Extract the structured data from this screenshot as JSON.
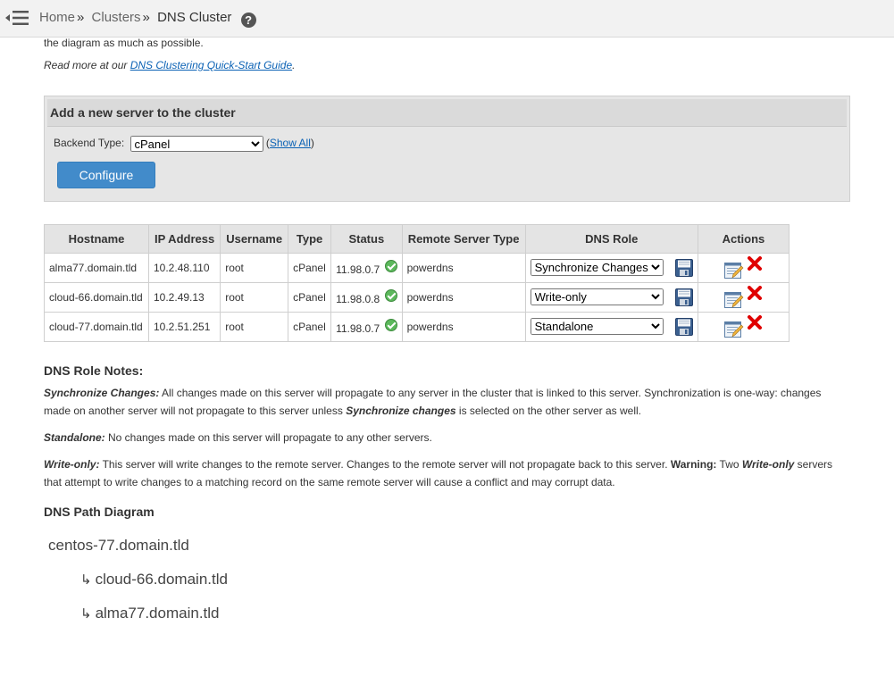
{
  "breadcrumb": {
    "home": "Home",
    "clusters": "Clusters",
    "current": "DNS Cluster",
    "sep1": "»",
    "sep2": "»"
  },
  "intro": {
    "text": "the diagram as much as possible.",
    "readmore_prefix": "Read more at our ",
    "readmore_link": "DNS Clustering Quick-Start Guide",
    "readmore_suffix": "."
  },
  "add_server": {
    "title": "Add a new server to the cluster",
    "backend_label": "Backend Type:",
    "backend_value": "cPanel",
    "show_all_open": "(",
    "show_all": "Show All",
    "show_all_close": ")",
    "configure_label": "Configure"
  },
  "table": {
    "headers": [
      "Hostname",
      "IP Address",
      "Username",
      "Type",
      "Status",
      "Remote Server Type",
      "DNS Role",
      "Actions"
    ],
    "rows": [
      {
        "hostname": "alma77.domain.tld",
        "ip": "10.2.48.110",
        "username": "root",
        "type": "cPanel",
        "status": "11.98.0.7",
        "remote_type": "powerdns",
        "dns_role": "Synchronize Changes"
      },
      {
        "hostname": "cloud-66.domain.tld",
        "ip": "10.2.49.13",
        "username": "root",
        "type": "cPanel",
        "status": "11.98.0.8",
        "remote_type": "powerdns",
        "dns_role": "Write-only"
      },
      {
        "hostname": "cloud-77.domain.tld",
        "ip": "10.2.51.251",
        "username": "root",
        "type": "cPanel",
        "status": "11.98.0.7",
        "remote_type": "powerdns",
        "dns_role": "Standalone"
      }
    ]
  },
  "notes": {
    "title": "DNS Role Notes:",
    "sync_label": "Synchronize Changes:",
    "sync_text1": " All changes made on this server will propagate to any server in the cluster that is linked to this server. Synchronization is one-way: changes made on another server will not propagate to this server unless ",
    "sync_emph": "Synchronize changes",
    "sync_text2": " is selected on the other server as well.",
    "standalone_label": "Standalone:",
    "standalone_text": " No changes made on this server will propagate to any other servers.",
    "writeonly_label": "Write-only:",
    "writeonly_text1": " This server will write changes to the remote server. Changes to the remote server will not propagate back to this server. ",
    "warning_label": "Warning:",
    "writeonly_text2": " Two ",
    "writeonly_emph": "Write-only",
    "writeonly_text3": " servers that attempt to write changes to a matching record on the same remote server will cause a conflict and may corrupt data."
  },
  "diagram": {
    "title": "DNS Path Diagram",
    "root": "centos-77.domain.tld",
    "arrow": "↳",
    "children": [
      "cloud-66.domain.tld",
      "alma77.domain.tld"
    ]
  },
  "colors": {
    "accent": "#428bca",
    "link": "#0b62b5",
    "status_ok": "#5cb85c",
    "delete": "#e00000"
  },
  "icons": [
    "menu-toggle-icon",
    "help-icon",
    "status-ok-icon",
    "save-icon",
    "edit-icon",
    "delete-icon"
  ]
}
